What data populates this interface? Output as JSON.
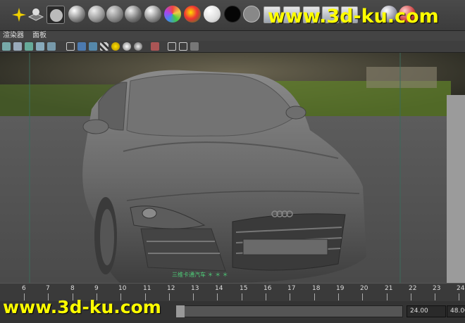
{
  "shelf": {
    "menu_fragments": [
      "",
      "",
      "",
      "",
      "",
      "",
      "",
      ""
    ],
    "icons": [
      "star-tool-icon",
      "shader-ball-icon",
      "material-sphere-icon"
    ],
    "colors": {
      "accent": "#ffff00",
      "bg": "#3c3c3c"
    }
  },
  "panel_menu": {
    "renderer": "渲染器",
    "panels": "面板"
  },
  "viewport": {
    "hud_label": "三维卡通汽车 ＊ ＊ ＊"
  },
  "time_slider": {
    "ticks": [
      "6",
      "7",
      "8",
      "9",
      "10",
      "11",
      "12",
      "13",
      "14",
      "15",
      "16",
      "17",
      "18",
      "19",
      "20",
      "21",
      "22",
      "23",
      "24"
    ]
  },
  "range": {
    "end_time": "24.00",
    "max_time": "48.00"
  },
  "watermark": "www.3d-ku.com"
}
